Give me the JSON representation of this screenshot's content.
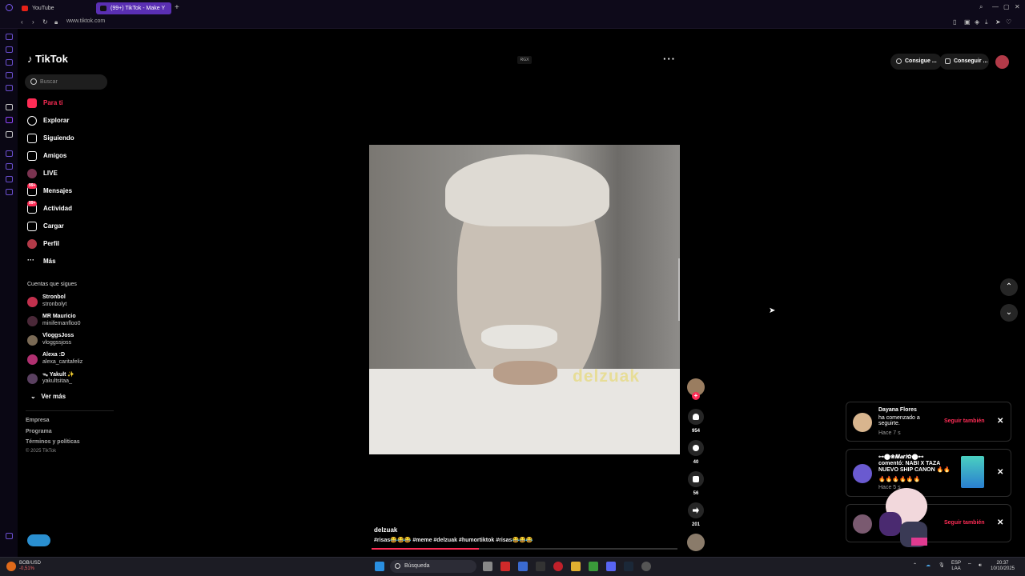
{
  "browser": {
    "tabs": [
      {
        "label": "YouTube",
        "color": "#e62117"
      },
      {
        "label": "(99+) TikTok - Make Y",
        "color": "#111111"
      }
    ],
    "url": "www.tiktok.com"
  },
  "sidebar": {
    "logo": "TikTok",
    "search_placeholder": "Buscar",
    "nav": [
      {
        "label": "Para ti",
        "icon": "home-icon",
        "active": true
      },
      {
        "label": "Explorar",
        "icon": "compass-icon"
      },
      {
        "label": "Siguiendo",
        "icon": "following-icon"
      },
      {
        "label": "Amigos",
        "icon": "friends-icon"
      },
      {
        "label": "LIVE",
        "icon": "live-icon"
      },
      {
        "label": "Mensajes",
        "icon": "messages-icon",
        "badge": "99+"
      },
      {
        "label": "Actividad",
        "icon": "activity-icon",
        "badge": "99+"
      },
      {
        "label": "Cargar",
        "icon": "upload-icon"
      },
      {
        "label": "Perfil",
        "icon": "profile-icon"
      },
      {
        "label": "Más",
        "icon": "more-icon"
      }
    ],
    "following_header": "Cuentas que sigues",
    "accounts": [
      {
        "name": "Stronbol",
        "handle": "stronbolyt"
      },
      {
        "name": "MR Mauricio",
        "handle": "minifemanfloo0"
      },
      {
        "name": "VloggsJoss",
        "handle": "vloggssjoss"
      },
      {
        "name": "Alexa :D",
        "handle": "alexa_caritafeliz"
      },
      {
        "name": "ᯓ Yakult ✨",
        "handle": "yakultsitaa_"
      }
    ],
    "see_more": "Ver más",
    "footer": [
      "Empresa",
      "Programa",
      "Términos y políticas"
    ],
    "copyright": "© 2025 TikTok"
  },
  "header": {
    "rgx": "RGX",
    "coins_label": "Consigue ...",
    "app_label": "Conseguir ...",
    "more": "···"
  },
  "video": {
    "watermark": "delzuak",
    "author": "delzuak",
    "caption": "#risas😂😂😂  #meme  #delzuak  #humortiktok  #risas😂😂😂",
    "progress": 0.35,
    "likes": "954",
    "comments": "40",
    "saves": "56",
    "shares": "201"
  },
  "notifications": [
    {
      "name": "Dayana Flores",
      "text": "ha comenzado a seguirte.",
      "time": "Hace 7 s",
      "action": "Seguir también"
    },
    {
      "name": "⊶⬤❀𝑴𝒂𝒓𝒊✿⬤⊷",
      "text": "comentó: NABI X TAZA NUEVO SHIP CANON 🔥🔥",
      "extra": "🔥🔥🔥🔥🔥🔥",
      "time": "Hace 5 s"
    },
    {
      "action": "Seguir también"
    }
  ],
  "taskbar": {
    "stock_name": "BOB/USD",
    "stock_change": "-0,51%",
    "search_label": "Búsqueda",
    "lang": "ESP",
    "lang2": "LAA",
    "time": "20:37",
    "date": "10/10/2025"
  }
}
